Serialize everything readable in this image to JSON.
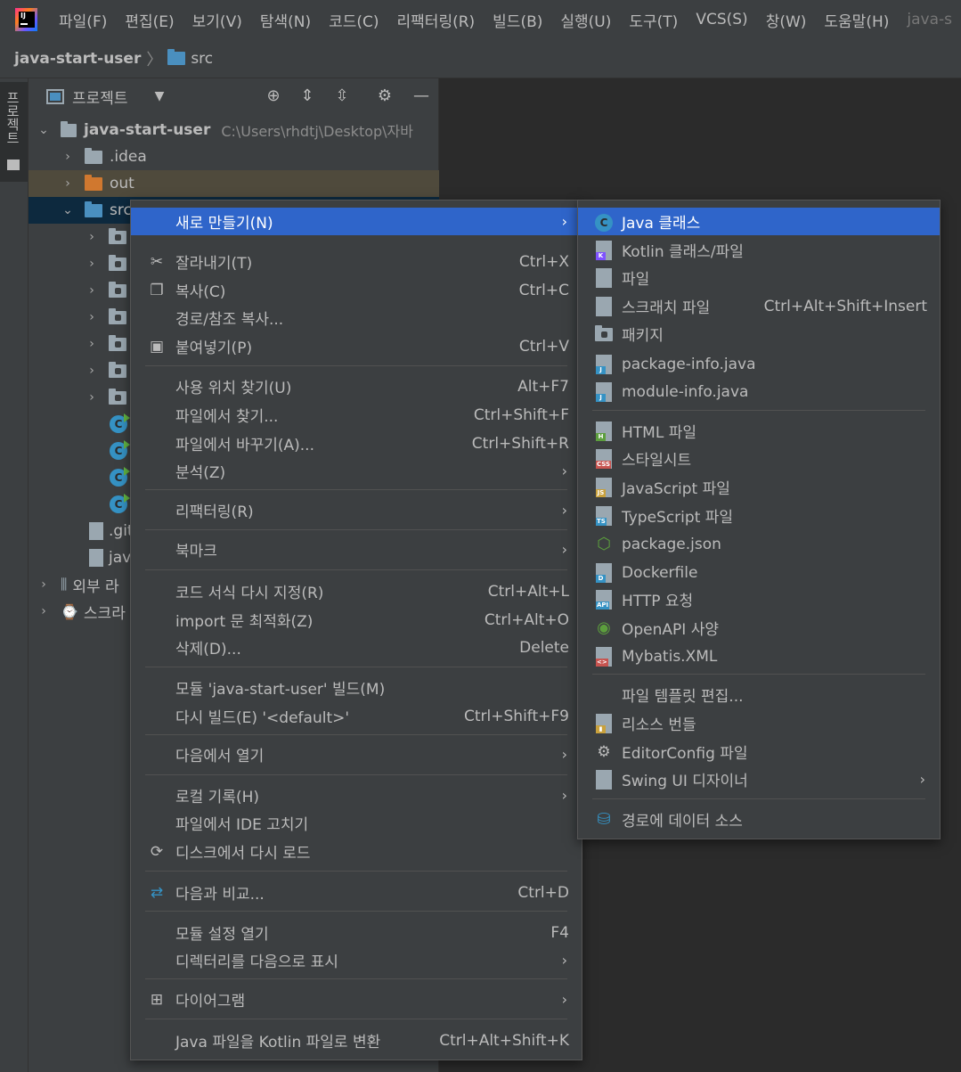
{
  "menubar": {
    "items": [
      "파일(F)",
      "편집(E)",
      "보기(V)",
      "탐색(N)",
      "코드(C)",
      "리팩터링(R)",
      "빌드(B)",
      "실행(U)",
      "도구(T)",
      "VCS(S)",
      "창(W)",
      "도움말(H)"
    ],
    "window_title": "java-s"
  },
  "breadcrumb": {
    "project": "java-start-user",
    "folder": "src"
  },
  "left_strip": {
    "tab_label": "프로젝트"
  },
  "panel": {
    "title": "프로젝트"
  },
  "tree": {
    "root": "java-start-user",
    "root_path": "C:\\Users\\rhdtj\\Desktop\\자바",
    "idea": ".idea",
    "out": "out",
    "src": "src",
    "gitignore": ".git",
    "iml": "jav",
    "external_libs": "외부 라",
    "scratches": "스크라"
  },
  "context_menu": {
    "new": "새로 만들기(N)",
    "cut": "잘라내기(T)",
    "cut_sc": "Ctrl+X",
    "copy": "복사(C)",
    "copy_sc": "Ctrl+C",
    "copy_path": "경로/참조 복사...",
    "paste": "붙여넣기(P)",
    "paste_sc": "Ctrl+V",
    "find_usages": "사용 위치 찾기(U)",
    "find_usages_sc": "Alt+F7",
    "find_in_files": "파일에서 찾기...",
    "find_in_files_sc": "Ctrl+Shift+F",
    "replace_in_files": "파일에서 바꾸기(A)...",
    "replace_in_files_sc": "Ctrl+Shift+R",
    "analyze": "분석(Z)",
    "refactor": "리팩터링(R)",
    "bookmarks": "북마크",
    "reformat": "코드 서식 다시 지정(R)",
    "reformat_sc": "Ctrl+Alt+L",
    "optimize_imports": "import 문 최적화(Z)",
    "optimize_imports_sc": "Ctrl+Alt+O",
    "delete": "삭제(D)...",
    "delete_sc": "Delete",
    "build_module": "모듈 'java-start-user' 빌드(M)",
    "rebuild": "다시 빌드(E) '<default>'",
    "rebuild_sc": "Ctrl+Shift+F9",
    "open_in": "다음에서 열기",
    "local_history": "로컬 기록(H)",
    "repair_ide": "파일에서 IDE 고치기",
    "reload": "디스크에서 다시 로드",
    "compare": "다음과 비교...",
    "compare_sc": "Ctrl+D",
    "module_settings": "모듈 설정 열기",
    "module_settings_sc": "F4",
    "mark_dir": "디렉터리를 다음으로 표시",
    "diagram": "다이어그램",
    "convert": "Java 파일을 Kotlin 파일로 변환",
    "convert_sc": "Ctrl+Alt+Shift+K"
  },
  "submenu": {
    "java_class": "Java 클래스",
    "kotlin": "Kotlin 클래스/파일",
    "file": "파일",
    "scratch": "스크래치 파일",
    "scratch_sc": "Ctrl+Alt+Shift+Insert",
    "package": "패키지",
    "package_info": "package-info.java",
    "module_info": "module-info.java",
    "html": "HTML 파일",
    "stylesheet": "스타일시트",
    "javascript": "JavaScript 파일",
    "typescript": "TypeScript 파일",
    "package_json": "package.json",
    "dockerfile": "Dockerfile",
    "http": "HTTP 요청",
    "openapi": "OpenAPI 사양",
    "mybatis": "Mybatis.XML",
    "edit_templates": "파일 템플릿 편집...",
    "resource_bundle": "리소스 번들",
    "editorconfig": "EditorConfig 파일",
    "swing": "Swing UI 디자이너",
    "datasource": "경로에 데이터 소스"
  },
  "badges": {
    "h": "H",
    "css": "CSS",
    "js": "JS",
    "ts": "TS",
    "d": "D",
    "api": "API",
    "xml": "<>",
    "j": "J",
    "c": "C"
  },
  "colors": {
    "highlight": "#2f65ca",
    "menu_bg": "#3c3f41",
    "folder_blue": "#4a8fbf",
    "folder_orange": "#d0782f"
  }
}
